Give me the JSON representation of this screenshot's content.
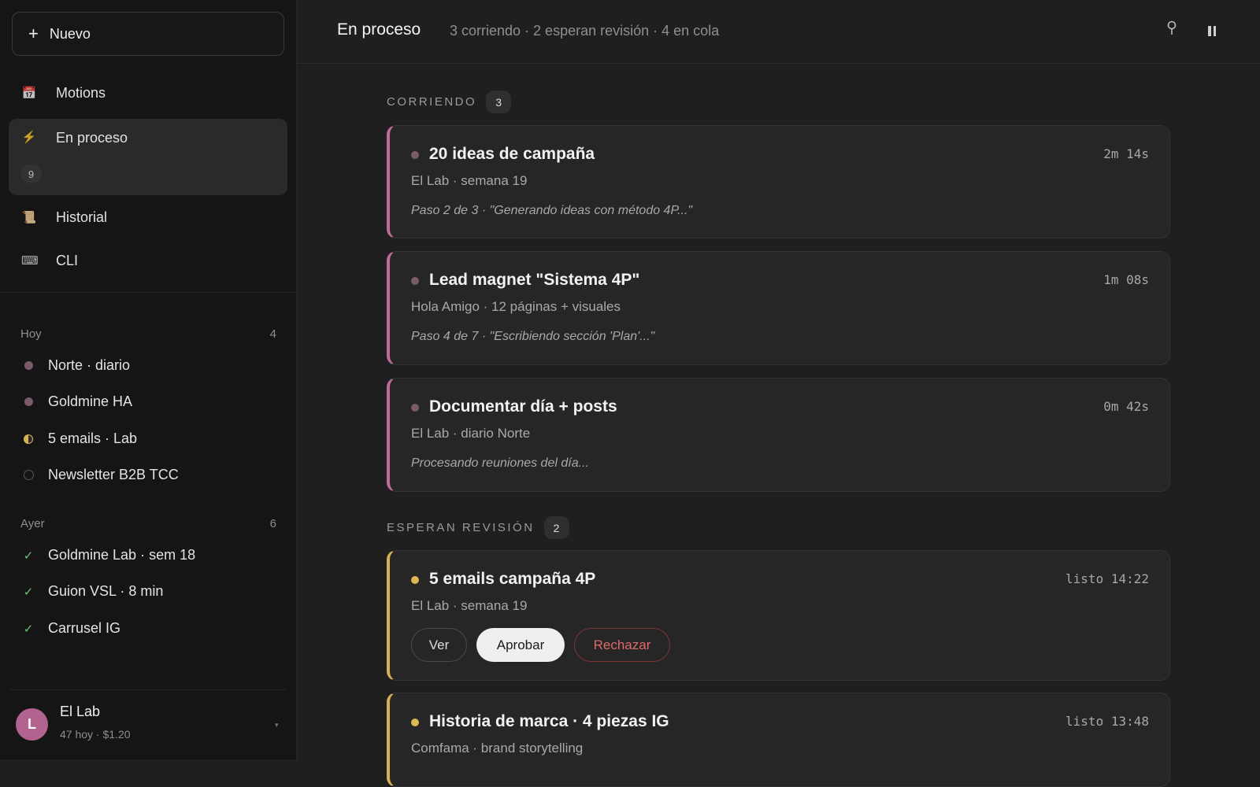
{
  "sidebar": {
    "new_button": {
      "icon": "plus-icon",
      "label": "Nuevo"
    },
    "nav": [
      {
        "icon": "calendar-icon",
        "glyph": "📅",
        "label": "Motions"
      },
      {
        "icon": "lightning-icon",
        "glyph": "⚡",
        "label": "En proceso",
        "badge": "9",
        "active": true
      },
      {
        "icon": "scroll-icon",
        "glyph": "📜",
        "label": "Historial"
      },
      {
        "icon": "keyboard-icon",
        "glyph": "⌨",
        "label": "CLI"
      }
    ],
    "groups": [
      {
        "label": "Hoy",
        "count": "4",
        "items": [
          {
            "status": "dot",
            "label": "Norte · diario"
          },
          {
            "status": "dot",
            "label": "Goldmine HA"
          },
          {
            "status": "half",
            "label": "5 emails · Lab"
          },
          {
            "status": "empty",
            "label": "Newsletter B2B TCC"
          }
        ]
      },
      {
        "label": "Ayer",
        "count": "6",
        "items": [
          {
            "status": "check",
            "glyph": "✓",
            "label": "Goldmine Lab · sem 18"
          },
          {
            "status": "check",
            "glyph": "✓",
            "label": "Guion VSL · 8 min"
          },
          {
            "status": "check",
            "glyph": "✓",
            "label": "Carrusel IG"
          }
        ]
      }
    ],
    "user": {
      "initial": "L",
      "name": "El Lab",
      "meta": "47 hoy · $1.20",
      "caret": "▾",
      "avatar_color": "#b1628f"
    }
  },
  "header": {
    "title": "En proceso",
    "subtitle": "3 corriendo · 2 esperan revisión · 4 en cola",
    "icons": [
      "pin-icon",
      "pause-icon"
    ]
  },
  "sections": {
    "running": {
      "label": "CORRIENDO",
      "count": "3",
      "cards": [
        {
          "title": "20 ideas de campaña",
          "time": "2m 14s",
          "sub": "El Lab · semana 19",
          "step": "Paso 2 de 3 · \"Generando ideas con método 4P...\""
        },
        {
          "title": "Lead magnet \"Sistema 4P\"",
          "time": "1m 08s",
          "sub": "Hola Amigo · 12 páginas + visuales",
          "step": "Paso 4 de 7 · \"Escribiendo sección 'Plan'...\""
        },
        {
          "title": "Documentar día + posts",
          "time": "0m 42s",
          "sub": "El Lab · diario Norte",
          "step": "Procesando reuniones del día..."
        }
      ]
    },
    "review": {
      "label": "ESPERAN REVISIÓN",
      "count": "2",
      "cards": [
        {
          "title": "5 emails campaña 4P",
          "time": "listo 14:22",
          "sub": "El Lab · semana 19",
          "actions": {
            "view": "Ver",
            "approve": "Aprobar",
            "reject": "Rechazar"
          }
        },
        {
          "title": "Historia de marca · 4 piezas IG",
          "time": "listo 13:48",
          "sub": "Comfama · brand storytelling"
        }
      ]
    }
  },
  "colors": {
    "running_accent": "#c06a9c",
    "review_accent": "#d4b254",
    "reject": "#de6a6a",
    "done_check": "#6fbf77"
  }
}
